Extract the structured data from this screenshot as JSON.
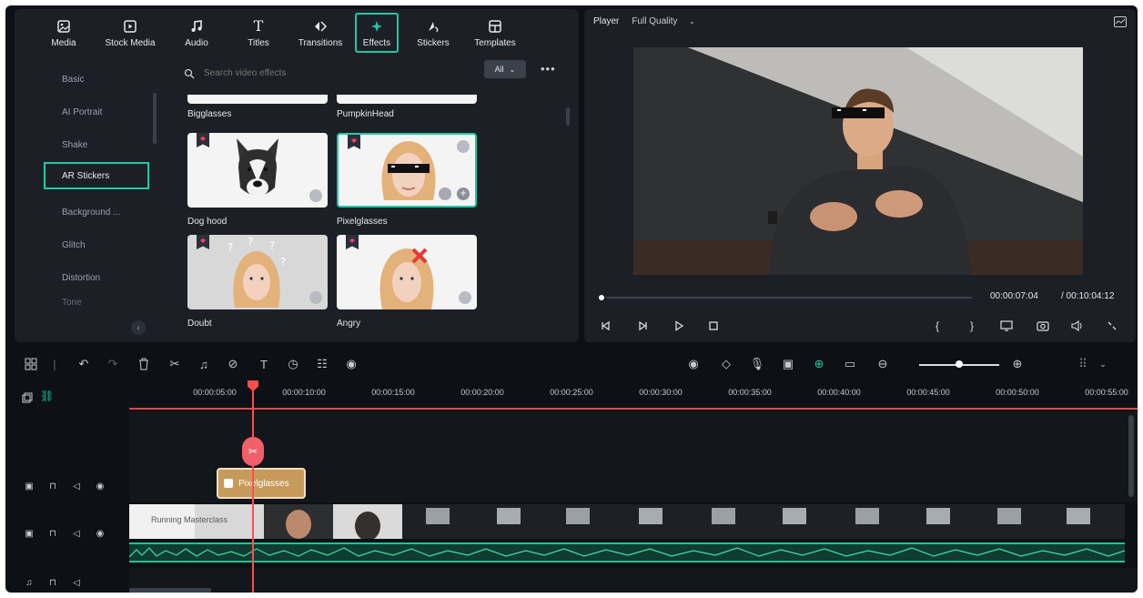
{
  "media_tabs": [
    {
      "label": "Media",
      "icon": "media-icon"
    },
    {
      "label": "Stock Media",
      "icon": "stock-media-icon"
    },
    {
      "label": "Audio",
      "icon": "music-note-icon"
    },
    {
      "label": "Titles",
      "icon": "text-t-icon"
    },
    {
      "label": "Transitions",
      "icon": "transitions-icon"
    },
    {
      "label": "Effects",
      "icon": "effects-icon",
      "active": true
    },
    {
      "label": "Stickers",
      "icon": "stickers-icon"
    },
    {
      "label": "Templates",
      "icon": "templates-icon"
    }
  ],
  "categories": [
    {
      "label": "Basic"
    },
    {
      "label": "AI Portrait"
    },
    {
      "label": "Shake"
    },
    {
      "label": "AR Stickers",
      "active": true
    },
    {
      "label": "Background ..."
    },
    {
      "label": "Glitch"
    },
    {
      "label": "Distortion"
    },
    {
      "label": "Tone"
    }
  ],
  "search": {
    "placeholder": "Search video effects",
    "filter": "All"
  },
  "effects": [
    {
      "label": "Bigglasses"
    },
    {
      "label": "PumpkinHead"
    },
    {
      "label": "Dog hood"
    },
    {
      "label": "Pixelglasses",
      "selected": true
    },
    {
      "label": "Doubt"
    },
    {
      "label": "Angry"
    }
  ],
  "player": {
    "label": "Player",
    "quality": "Full Quality",
    "time_current": "00:00:07:04",
    "time_total": "/ 00:10:04:12",
    "progress_fraction": 0.0
  },
  "timeline": {
    "ticks": [
      "00:00:05:00",
      "00:00:10:00",
      "00:00:15:00",
      "00:00:20:00",
      "00:00:25:00",
      "00:00:30:00",
      "00:00:35:00",
      "00:00:40:00",
      "00:00:45:00",
      "00:00:50:00",
      "00:00:55:00"
    ],
    "effect_clip": "Pixelglasses",
    "video_clip_title": "Running Masterclass"
  },
  "colors": {
    "accent": "#20c9a5",
    "playhead": "#ff4d4f",
    "effect_clip": "#c69a5a",
    "audio": "#27c28f"
  }
}
